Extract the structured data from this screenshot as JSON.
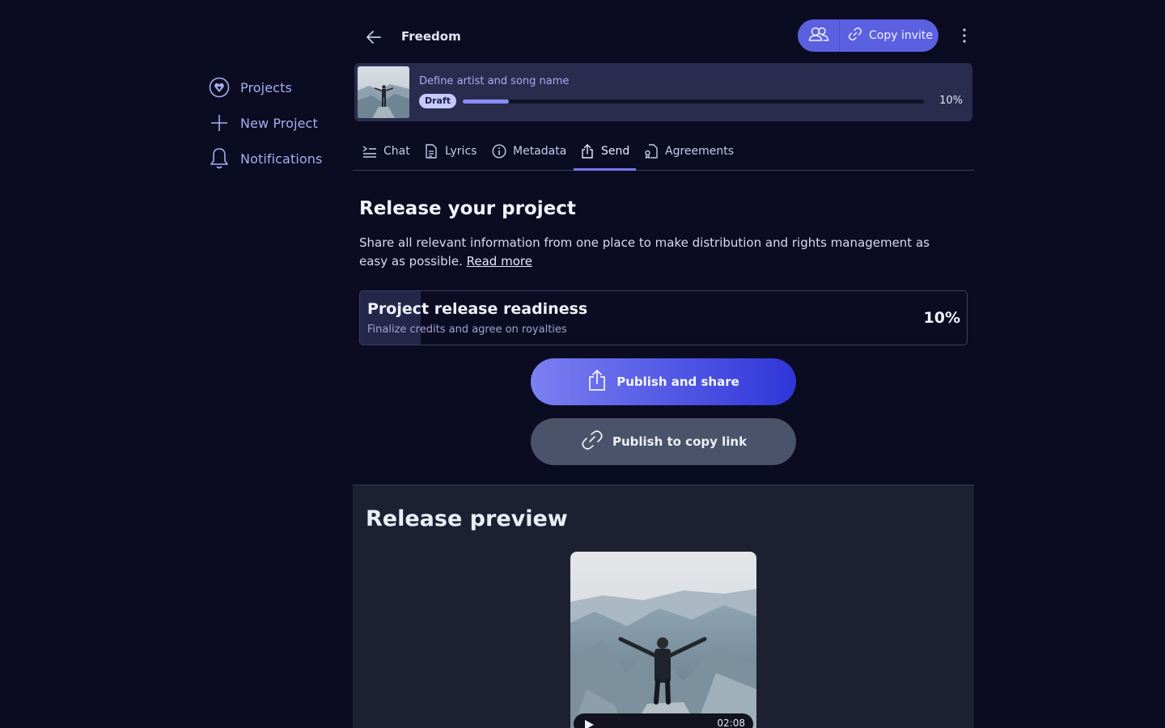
{
  "sidebar": {
    "items": [
      {
        "label": "Projects",
        "icon": "logo-heart-icon"
      },
      {
        "label": "New Project",
        "icon": "plus-icon"
      },
      {
        "label": "Notifications",
        "icon": "bell-icon"
      }
    ]
  },
  "header": {
    "title": "Freedom",
    "copy_invite_label": "Copy invite"
  },
  "status_card": {
    "title": "Define artist and song name",
    "badge": "Draft",
    "progress_text": "10%",
    "progress_value": 0.1
  },
  "tabs": [
    {
      "label": "Chat",
      "icon": "chat-lines-icon"
    },
    {
      "label": "Lyrics",
      "icon": "document-icon"
    },
    {
      "label": "Metadata",
      "icon": "info-icon"
    },
    {
      "label": "Send",
      "icon": "share-icon",
      "active": true
    },
    {
      "label": "Agreements",
      "icon": "agreement-icon"
    }
  ],
  "release": {
    "title": "Release your project",
    "description": "Share all relevant information from one place to make distribution and rights management as easy as possible.",
    "read_more": "Read more"
  },
  "readiness": {
    "title": "Project release readiness",
    "subtitle": "Finalize credits and agree on royalties",
    "percent_text": "10%",
    "value": 0.1
  },
  "actions": {
    "publish_share": "Publish and share",
    "publish_copy_link": "Publish to copy link"
  },
  "preview": {
    "title": "Release preview",
    "duration": "02:08"
  },
  "colors": {
    "background": "#0b0c22",
    "accent": "#5b60e0",
    "preview_bg": "#1d2030"
  }
}
